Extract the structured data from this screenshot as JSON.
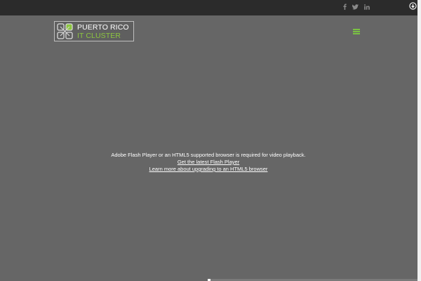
{
  "top_bar": {
    "social": [
      {
        "name": "facebook-icon",
        "glyph": "f"
      },
      {
        "name": "twitter-icon",
        "glyph": "t"
      },
      {
        "name": "linkedin-icon",
        "glyph": "in"
      }
    ],
    "corner_icon": "play-circle-icon"
  },
  "header": {
    "logo": {
      "line1": "PUERTO RICO",
      "line2": "IT CLUSTER"
    },
    "menu_icon": "hamburger-menu-icon"
  },
  "video_fallback": {
    "message": "Adobe Flash Player or an HTML5 supported browser is required for video playback.",
    "flash_link": "Get the latest Flash Player",
    "html5_link": "Learn more about upgrading to an HTML5 browser"
  },
  "colors": {
    "page_background": "#666666",
    "top_bar": "#2b2b2b",
    "accent_green": "#8cc63f",
    "text": "#ffffff"
  }
}
